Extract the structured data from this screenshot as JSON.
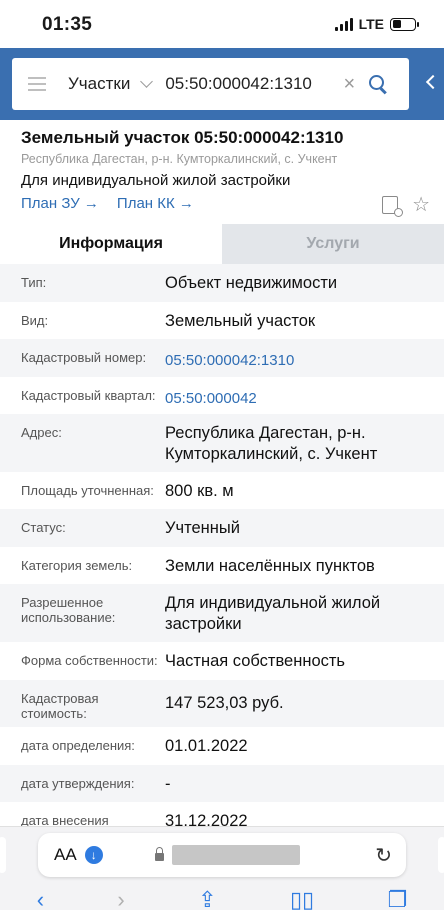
{
  "status": {
    "time": "01:35",
    "network": "LTE"
  },
  "search": {
    "type": "Участки",
    "query": "05:50:000042:1310"
  },
  "header": {
    "title": "Земельный участок 05:50:000042:1310",
    "address": "Республика Дагестан, р-н. Кумторкалинский, с. Учкент",
    "purpose": "Для индивидуальной жилой застройки",
    "link_plan_zu": "План ЗУ",
    "link_plan_kk": "План КК"
  },
  "tabs": {
    "info": "Информация",
    "services": "Услуги"
  },
  "rows": [
    {
      "label": "Тип:",
      "value": "Объект недвижимости"
    },
    {
      "label": "Вид:",
      "value": "Земельный участок"
    },
    {
      "label": "Кадастровый номер:",
      "value": "05:50:000042:1310"
    },
    {
      "label": "Кадастровый квартал:",
      "value": "05:50:000042"
    },
    {
      "label": "Адрес:",
      "value": "Республика Дагестан, р-н. Кумторкалинский, с. Учкент"
    },
    {
      "label": "Площадь уточненная:",
      "value": "800 кв. м"
    },
    {
      "label": "Статус:",
      "value": "Учтенный"
    },
    {
      "label": "Категория земель:",
      "value": "Земли населённых пунктов"
    },
    {
      "label": "Разрешенное использование:",
      "value": "Для индивидуальной жилой застройки"
    },
    {
      "label": "Форма собственности:",
      "value": "Частная собственность"
    },
    {
      "label": "Кадастровая стоимость:",
      "value": "147 523,03 руб."
    },
    {
      "label": "дата определения:",
      "value": "01.01.2022"
    },
    {
      "label": "дата утверждения:",
      "value": "-"
    },
    {
      "label": "дата внесения",
      "value": "31.12.2022"
    }
  ],
  "browser": {
    "aa": "AA"
  },
  "icons": {
    "back": "chevron-left-icon",
    "forward": "chevron-right-icon",
    "share": "share-icon",
    "bookmarks": "book-icon",
    "tabs": "tabs-icon"
  }
}
